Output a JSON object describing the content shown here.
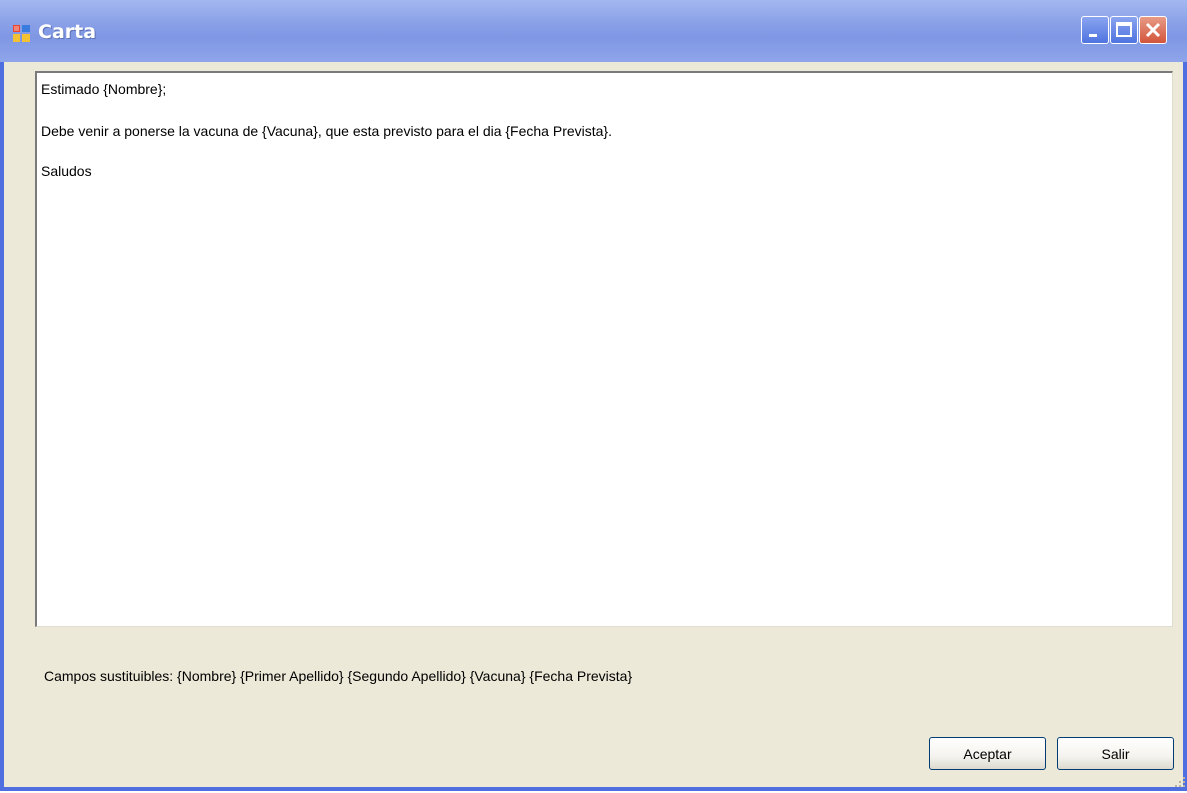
{
  "window": {
    "title": "Carta",
    "icon": "application-icon",
    "controls": [
      "minimize-icon",
      "maximize-icon",
      "close-icon"
    ]
  },
  "editor": {
    "lines": [
      "Estimado {Nombre};",
      "Debe venir a ponerse la vacuna de {Vacuna}, que esta previsto para el dia {Fecha Prevista}.",
      "Saludos"
    ]
  },
  "fields": {
    "label": "Campos sustituibles: {Nombre} {Primer Apellido} {Segundo Apellido} {Vacuna} {Fecha Prevista}"
  },
  "buttons": {
    "accept": "Aceptar",
    "exit": "Salir"
  },
  "colors": {
    "titlebar": "#8ba2e8",
    "window_border": "#4f6ee0",
    "dialog_bg": "#ece9d8",
    "close_button": "#d2553b"
  }
}
